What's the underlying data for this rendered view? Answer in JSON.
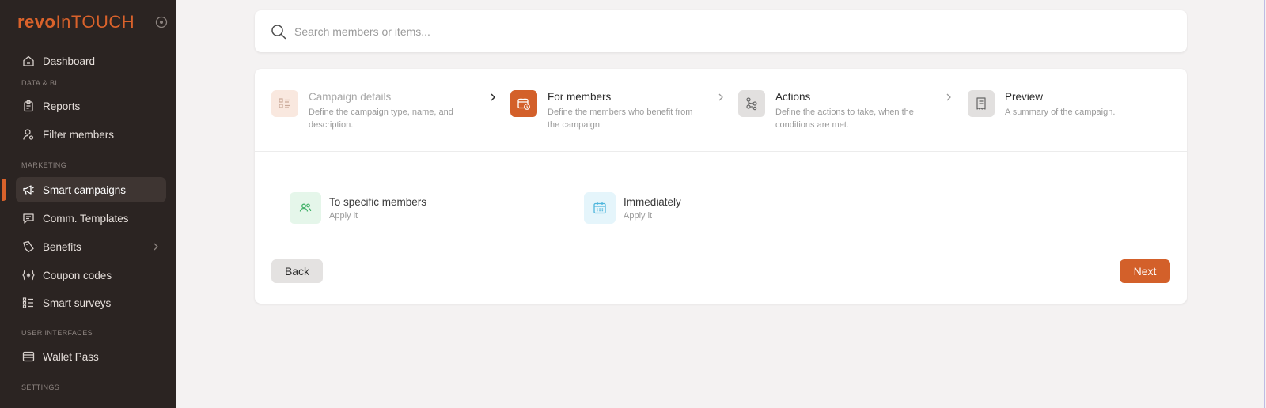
{
  "brand": {
    "part1": "revo",
    "part2": "InTOUCH",
    "accent": "#d9622b"
  },
  "sidebar": {
    "items": {
      "dashboard": "Dashboard",
      "reports": "Reports",
      "filter_members": "Filter members",
      "smart_campaigns": "Smart campaigns",
      "comm_templates": "Comm. Templates",
      "benefits": "Benefits",
      "coupon_codes": "Coupon codes",
      "smart_surveys": "Smart surveys",
      "wallet_pass": "Wallet Pass"
    },
    "sections": {
      "data_bi": "DATA & BI",
      "marketing": "MARKETING",
      "user_interfaces": "USER INTERFACES",
      "settings": "SETTINGS"
    }
  },
  "search": {
    "placeholder": "Search members or items..."
  },
  "steps": [
    {
      "title": "Campaign details",
      "desc": "Define the campaign type, name, and description.",
      "icon": "checklist-icon"
    },
    {
      "title": "For members",
      "desc": "Define the members who benefit from the campaign.",
      "icon": "calendar-clock-icon"
    },
    {
      "title": "Actions",
      "desc": "Define the actions to take, when the conditions are met.",
      "icon": "flow-icon"
    },
    {
      "title": "Preview",
      "desc": "A summary of the campaign.",
      "icon": "receipt-icon"
    }
  ],
  "options": [
    {
      "title": "To specific members",
      "desc": "Apply it",
      "icon": "users-icon"
    },
    {
      "title": "Immediately",
      "desc": "Apply it",
      "icon": "calendar-icon"
    }
  ],
  "buttons": {
    "back": "Back",
    "next": "Next"
  }
}
